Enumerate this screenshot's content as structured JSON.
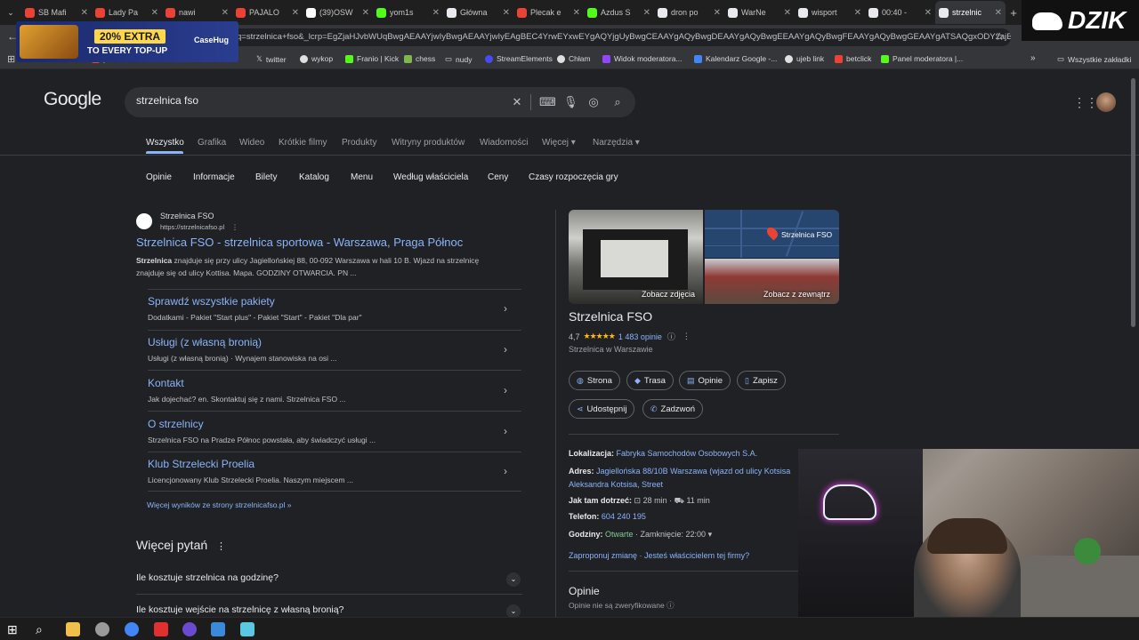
{
  "browser": {
    "tabs": [
      {
        "label": "SB Mafi",
        "color": "#ea4335"
      },
      {
        "label": "Lady Pa",
        "color": "#ea4335"
      },
      {
        "label": "nawi",
        "color": "#ea4335"
      },
      {
        "label": "PAJALO",
        "color": "#ea4335"
      },
      {
        "label": "(39)OSW",
        "color": "#ffffff"
      },
      {
        "label": "yom1s",
        "color": "#53fc18"
      },
      {
        "label": "Główna",
        "color": "#e8eaed"
      },
      {
        "label": "Plecak e",
        "color": "#ea4335"
      },
      {
        "label": "Azdus S",
        "color": "#53fc18"
      },
      {
        "label": "dron po",
        "color": "#e8eaed"
      },
      {
        "label": "WarNe",
        "color": "#e8eaed"
      },
      {
        "label": "wisport",
        "color": "#e8eaed"
      },
      {
        "label": "00:40 -",
        "color": "#e8eaed"
      },
      {
        "label": "strzelnic",
        "color": "#e8eaed"
      }
    ],
    "url": "q=strzelnica+fso&_lcrp=EgZjaHJvbWUqBwgAEAAYjwIyBwgAEAAYjwIyEAgBEC4YrwEYxwEYgAQYjgUyBwgCEAAYgAQyBwgDEAAYgAQyBwgEEAAYgAQyBwgFEAAYgAQyBwgGEAAYgATSAQgxODY2ajBqN6g...",
    "bookmarks": [
      "twitter",
      "wykop",
      "Franio | Kick",
      "chess",
      "nudy",
      "StreamElements",
      "Chłam",
      "Widok moderatora...",
      "Kalendarz Google -...",
      "ujeb link",
      "betclick",
      "Panel moderatora |...",
      "Wszystkie zakładki"
    ],
    "bookmarks_partial": [
      "yotube",
      "",
      "",
      "ior"
    ]
  },
  "overlay": {
    "ad_percent": "20% EXTRA",
    "ad_subtitle": "TO EVERY TOP-UP",
    "ad_brand": "CaseHug",
    "streamer_logo": "DZIK"
  },
  "google": {
    "logo": "Google",
    "query": "strzelnica fso",
    "nav": [
      "Wszystko",
      "Grafika",
      "Wideo",
      "Krótkie filmy",
      "Produkty",
      "Witryny produktów",
      "Wiadomości",
      "Więcej",
      "Narzędzia"
    ],
    "chips": [
      "Opinie",
      "Informacje",
      "Bilety",
      "Katalog",
      "Menu",
      "Według właściciela",
      "Ceny",
      "Czasy rozpoczęcia gry"
    ]
  },
  "result": {
    "site_name": "Strzelnica FSO",
    "site_url": "https://strzelnicafso.pl",
    "title": "Strzelnica FSO - strzelnica sportowa - Warszawa, Praga Północ",
    "snippet_bold": "Strzelnica",
    "snippet_1": " znajduje się przy ulicy Jagiellońskiej 88, 00-092 Warszawa w hali 10 B. Wjazd na strzelnicę",
    "snippet_2": "znajduje się od ulicy Kottisa. Mapa. GODZINY OTWARCIA. PN ...",
    "sitelinks": [
      {
        "title": "Sprawdź wszystkie pakiety",
        "desc": "Dodatkami - Pakiet \"Start plus\" - Pakiet \"Start\" - Pakiet \"Dla par\""
      },
      {
        "title": "Usługi (z własną bronią)",
        "desc": "Usługi (z własną bronią) · Wynajem stanowiska na osi ..."
      },
      {
        "title": "Kontakt",
        "desc": "Jak dojechać? en. Skontaktuj się z nami. Strzelnica FSO ..."
      },
      {
        "title": "O strzelnicy",
        "desc": "Strzelnica FSO na Pradze Północ powstała, aby świadczyć usługi ..."
      },
      {
        "title": "Klub Strzelecki Proelia",
        "desc": "Licencjonowany Klub Strzelecki Proelia. Naszym miejscem ..."
      }
    ],
    "more_results": "Więcej wyników ze strony strzelnicafso.pl »"
  },
  "paa": {
    "title": "Więcej pytań",
    "questions": [
      "Ile kosztuje strzelnica na godzinę?",
      "Ile kosztuje wejście na strzelnicę z własną bronią?"
    ]
  },
  "panel": {
    "photo_caption": "Zobacz zdjęcia",
    "map_label": "Strzelnica FSO",
    "outside_caption": "Zobacz z zewnątrz",
    "title": "Strzelnica FSO",
    "rating": "4,7",
    "stars": "★★★★★",
    "reviews": "1 483 opinie",
    "category": "Strzelnica w Warszawie",
    "buttons": [
      "Strona",
      "Trasa",
      "Opinie",
      "Zapisz",
      "Udostępnij",
      "Zadzwoń"
    ],
    "location_label": "Lokalizacja:",
    "location_value": "Fabryka Samochodów Osobowych S.A.",
    "address_label": "Adres:",
    "address_value_1": "Jagiellońska 88/10B Warszawa (wjazd od ulicy Kotsisa",
    "address_value_2": "Aleksandra Kotsisa, Street",
    "route_label": "Jak tam dotrzeć:",
    "route_transit": "28 min",
    "route_car": "11 min",
    "phone_label": "Telefon:",
    "phone_value": "604 240 195",
    "hours_label": "Godziny:",
    "hours_status": "Otwarte",
    "hours_close": " · Zamknięcie: 22:00",
    "suggest_edit": "Zaproponuj zmianę",
    "owner": "Jesteś właścicielem tej firmy?",
    "reviews_title": "Opinie",
    "reviews_sub": "Opinie nie są zweryfikowane"
  }
}
